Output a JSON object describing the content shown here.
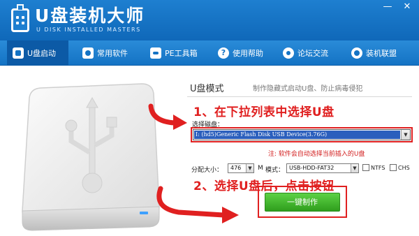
{
  "app": {
    "title": "U盘装机大师",
    "subtitle": "U DISK INSTALLED MASTERS",
    "minimize": "—",
    "close": "✕"
  },
  "nav": {
    "items": [
      {
        "label": "U盘启动",
        "icon": "usb-icon"
      },
      {
        "label": "常用软件",
        "icon": "gear-icon"
      },
      {
        "label": "PE工具箱",
        "icon": "toolbox-icon"
      },
      {
        "label": "使用帮助",
        "icon": "help-icon"
      },
      {
        "label": "论坛交流",
        "icon": "chat-icon"
      },
      {
        "label": "装机联盟",
        "icon": "users-icon"
      }
    ],
    "active_index": 0
  },
  "panel": {
    "mode_title": "U盘模式",
    "mode_desc": "制作隐藏式启动U盘、防止病毒侵犯",
    "step1": "1、在下拉列表中选择U盘",
    "select_disk_label": "选择磁盘：",
    "selected_disk": "I: (hd5)Generic Flash Disk USB Device(3.76G)",
    "note": "注: 软件会自动选择当前插入的U盘",
    "alloc_label": "分配大小：",
    "alloc_value": "476",
    "alloc_unit": "M",
    "mode_label": "模式：",
    "mode_value": "USB-HDD-FAT32",
    "ntfs_label": "NTFS",
    "chs_label": "CHS",
    "step2": "2、选择U盘后，点击按钮",
    "make_button": "一键制作"
  },
  "colors": {
    "titlebar": "#1473c4",
    "annotation": "#e02020",
    "button": "#3fb32a"
  }
}
